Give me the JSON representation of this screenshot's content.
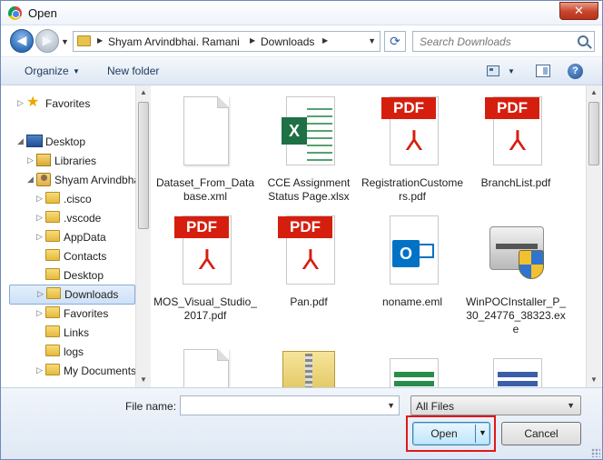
{
  "window": {
    "title": "Open",
    "close_glyph": "✕"
  },
  "addressbar": {
    "path": [
      "Shyam Arvindbhai. Ramani",
      "Downloads"
    ],
    "sep": "▶",
    "dropdown": "▼",
    "refresh": "⟳",
    "search_placeholder": "Search Downloads"
  },
  "nav": {
    "back": "◀",
    "forward": "▶",
    "recent": "▼"
  },
  "toolbar": {
    "organize": "Organize",
    "arrow": "▼",
    "new_folder": "New folder",
    "help": "?"
  },
  "navpane": {
    "items": [
      {
        "label": "Favorites",
        "icon": "star-icon",
        "exp": "▷"
      },
      {
        "label": "Desktop",
        "icon": "desktop-icon",
        "exp": "◢"
      },
      {
        "label": "Libraries",
        "icon": "library-icon",
        "exp": "▷"
      },
      {
        "label": "Shyam Arvindbhai",
        "icon": "user-folder-icon",
        "exp": "◢"
      },
      {
        "label": ".cisco",
        "icon": "folder-icon",
        "exp": "▷"
      },
      {
        "label": ".vscode",
        "icon": "folder-icon",
        "exp": "▷"
      },
      {
        "label": "AppData",
        "icon": "folder-icon",
        "exp": "▷"
      },
      {
        "label": "Contacts",
        "icon": "folder-icon",
        "exp": ""
      },
      {
        "label": "Desktop",
        "icon": "folder-icon",
        "exp": ""
      },
      {
        "label": "Downloads",
        "icon": "folder-icon",
        "exp": "▷"
      },
      {
        "label": "Favorites",
        "icon": "folder-icon",
        "exp": "▷"
      },
      {
        "label": "Links",
        "icon": "folder-icon",
        "exp": ""
      },
      {
        "label": "logs",
        "icon": "folder-icon",
        "exp": ""
      },
      {
        "label": "My Documents",
        "icon": "folder-icon",
        "exp": "▷"
      }
    ]
  },
  "files": [
    {
      "label": "Dataset_From_Database.xml",
      "type": "blank"
    },
    {
      "label": "CCE Assignment Status Page.xlsx",
      "type": "excel"
    },
    {
      "label": "RegistrationCustomers.pdf",
      "type": "pdf"
    },
    {
      "label": "BranchList.pdf",
      "type": "pdf"
    },
    {
      "label": "MOS_Visual_Studio_2017.pdf",
      "type": "pdf"
    },
    {
      "label": "Pan.pdf",
      "type": "pdf"
    },
    {
      "label": "noname.eml",
      "type": "outlook"
    },
    {
      "label": "WinPOCInstaller_P_30_24776_38323.exe",
      "type": "installer"
    }
  ],
  "file_icon_text": {
    "pdf": "PDF",
    "excel": "X",
    "outlook": "O",
    "acrobat": "⅄"
  },
  "bottom": {
    "file_name_label": "File name:",
    "file_name_value": "",
    "filter": "All Files",
    "open": "Open",
    "cancel": "Cancel",
    "arrow": "▼"
  },
  "scroll": {
    "up": "▲",
    "down": "▼"
  }
}
